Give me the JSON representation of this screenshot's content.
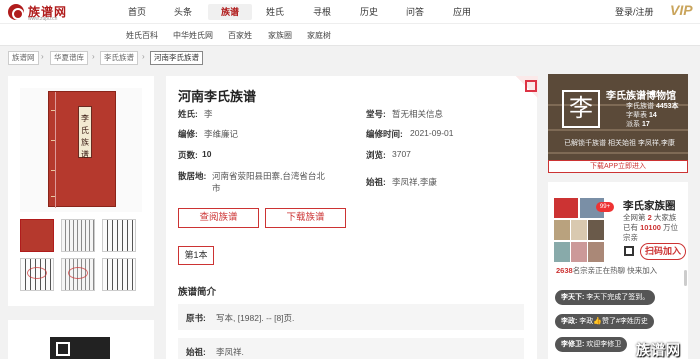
{
  "header": {
    "logo_name": "族谱网",
    "logo_url": "www.zupu.cn",
    "nav": [
      "首页",
      "头条",
      "族谱",
      "姓氏",
      "寻根",
      "历史",
      "问答",
      "应用"
    ],
    "active_nav": "族谱",
    "login": "登录/注册",
    "vip": "VIP"
  },
  "subnav": [
    "姓氏百科",
    "中华姓氏网",
    "百家姓",
    "家族圈",
    "家庭树"
  ],
  "breadcrumb": [
    "族谱网",
    "华夏谱库",
    "李氏族谱",
    "河南李氏族谱"
  ],
  "book": {
    "title": "河南李氏族谱",
    "cover_text": "李氏族谱",
    "fields": {
      "surname_label": "姓氏:",
      "surname": "李",
      "hall_label": "堂号:",
      "hall": "暂无相关信息",
      "editor_label": "编修:",
      "editor": "李维廉记",
      "edit_time_label": "编修时间:",
      "edit_time": "2021-09-01",
      "pages_label": "页数:",
      "pages": "10",
      "views_label": "浏览:",
      "views": "3707",
      "place_label": "散居地:",
      "place": "河南省荥阳县田寨,台湾省台北市",
      "ancestor_label": "始祖:",
      "ancestor": "李凤祥,李康"
    },
    "btn_view": "查阅族谱",
    "btn_download": "下载族谱",
    "volume": "第1本",
    "intro_title": "族谱简介",
    "intro": [
      {
        "key": "原书:",
        "value": "写本, [1982]. -- [8]页."
      },
      {
        "key": "始祖:",
        "value": "李凤祥."
      }
    ]
  },
  "museum": {
    "seal": "李",
    "title": "李氏族谱博物馆",
    "stats": [
      {
        "label": "李氏族谱",
        "value": "4453本"
      },
      {
        "label": "字辈表",
        "value": "14"
      },
      {
        "label": "派系",
        "value": "17"
      }
    ],
    "footer": "已解锁千族谱 相关始祖 李凤祥,李康",
    "link": "下载APP立即进入"
  },
  "clan": {
    "badge": "99+",
    "title": "李氏家族圈",
    "line1": "全网第",
    "rank": "2",
    "line1b": "大家族",
    "line2a": "已有",
    "members": "10100",
    "line2b": "万位宗亲",
    "join": "扫码加入",
    "count": "2638",
    "count_text": "名宗亲正在热聊 快来加入",
    "messages": [
      {
        "user": "李天下:",
        "text": "李天下完成了签到。"
      },
      {
        "user": "李政:",
        "text": "李政👍赞了#李姓历史"
      },
      {
        "user": "李修卫:",
        "text": "欢迎李修卫"
      }
    ]
  },
  "watermark": "族谱网",
  "colors": {
    "brand": "#b01c1c",
    "accent": "#cc3333"
  }
}
